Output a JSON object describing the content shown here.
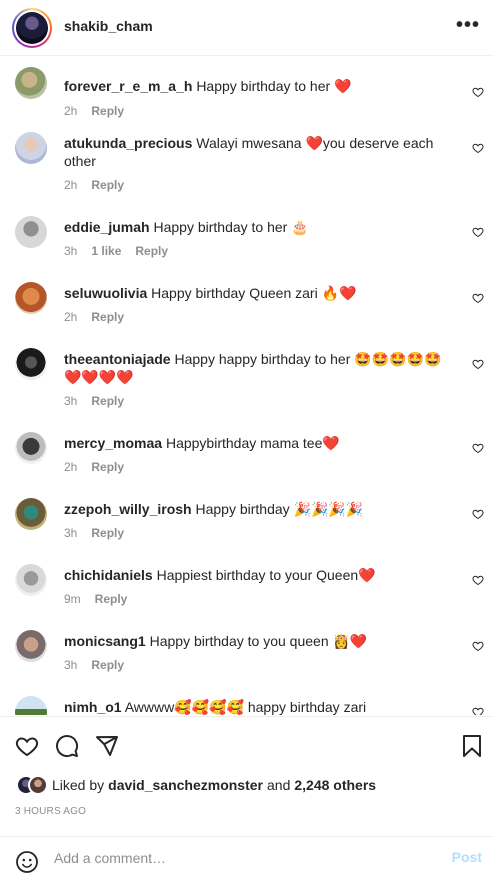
{
  "header": {
    "username": "shakib_cham",
    "more_label": "•••"
  },
  "comments": [
    {
      "user": "forever_r_e_m_a_h",
      "text": "Happy birthday to her ❤️",
      "time": "2h",
      "likes": "",
      "reply": "Reply"
    },
    {
      "user": "atukunda_precious",
      "text": "Walayi mwesana ❤️you deserve each other",
      "time": "2h",
      "likes": "",
      "reply": "Reply"
    },
    {
      "user": "eddie_jumah",
      "text": "Happy birthday to her 🎂",
      "time": "3h",
      "likes": "1 like",
      "reply": "Reply"
    },
    {
      "user": "seluwuolivia",
      "text": "Happy birthday Queen zari 🔥❤️",
      "time": "2h",
      "likes": "",
      "reply": "Reply"
    },
    {
      "user": "theeantoniajade",
      "text": "Happy happy birthday to her 🤩🤩🤩🤩🤩❤️❤️❤️❤️",
      "time": "3h",
      "likes": "",
      "reply": "Reply"
    },
    {
      "user": "mercy_momaa",
      "text": "Happybirthday mama tee❤️",
      "time": "2h",
      "likes": "",
      "reply": "Reply"
    },
    {
      "user": "zzepoh_willy_irosh",
      "text": "Happy birthday 🎉🎉🎉🎉",
      "time": "3h",
      "likes": "",
      "reply": "Reply"
    },
    {
      "user": "chichidaniels",
      "text": "Happiest birthday to your Queen❤️",
      "time": "9m",
      "likes": "",
      "reply": "Reply"
    },
    {
      "user": "monicsang1",
      "text": "Happy birthday to you queen 👸❤️",
      "time": "3h",
      "likes": "",
      "reply": "Reply"
    },
    {
      "user": "nimh_o1",
      "text": "Awwww🥰🥰🥰🥰 happy birthday zari",
      "time": "",
      "likes": "",
      "reply": ""
    }
  ],
  "likes": {
    "prefix": "Liked by",
    "user": "david_sanchezmonster",
    "joiner": "and",
    "others": "2,248 others"
  },
  "timestamp": "3 HOURS AGO",
  "add_comment": {
    "placeholder": "Add a comment…",
    "post_label": "Post"
  },
  "icons": [
    "more-icon",
    "comment-like-heart-icon",
    "like-heart-icon",
    "comment-bubble-icon",
    "share-paper-plane-icon",
    "save-bookmark-icon",
    "emoji-smiley-icon"
  ],
  "colors": {
    "text": "#262626",
    "secondary": "#8e8e8e",
    "post_disabled": "#b2dffc",
    "divider": "#efefef"
  }
}
